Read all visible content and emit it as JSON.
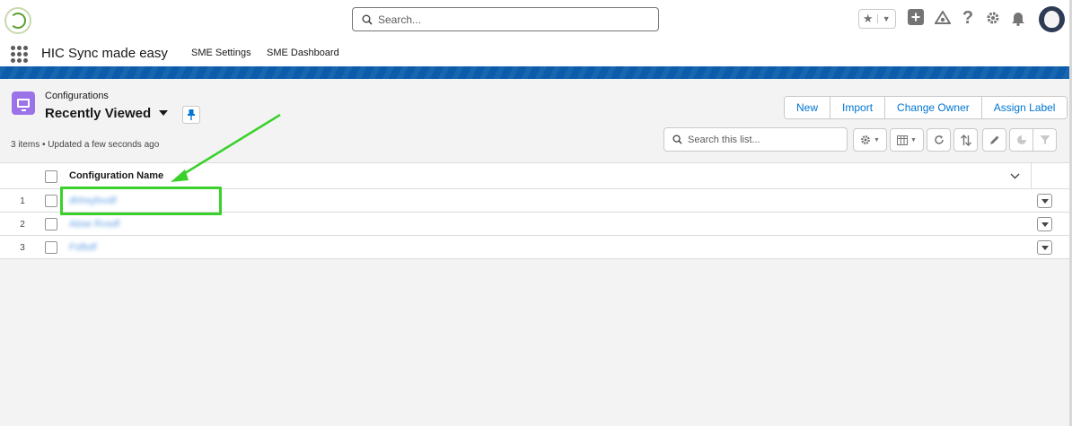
{
  "global_header": {
    "search_placeholder": "Search...",
    "utility_icons": [
      "favorites-star-icon",
      "add-icon",
      "trailhead-icon",
      "help-icon",
      "setup-gear-icon",
      "notifications-bell-icon"
    ],
    "help_glyph": "?"
  },
  "app_nav": {
    "app_name": "HIC Sync made easy",
    "items": [
      {
        "label": "SME Settings"
      },
      {
        "label": "SME Dashboard"
      }
    ]
  },
  "list_header": {
    "object_label": "Configurations",
    "list_view_name": "Recently Viewed",
    "meta_text": "3 items • Updated a few seconds ago",
    "actions": [
      {
        "label": "New"
      },
      {
        "label": "Import"
      },
      {
        "label": "Change Owner"
      },
      {
        "label": "Assign Label"
      }
    ],
    "search_placeholder": "Search this list...",
    "toolbar_icons": [
      "list-settings-icon",
      "display-as-table-icon",
      "refresh-icon",
      "sort-icon",
      "edit-list-icon",
      "charts-icon",
      "filter-icon"
    ]
  },
  "table": {
    "column_header": "Configuration Name",
    "rows": [
      {
        "num": "1",
        "name": "dhhsyfxvdf"
      },
      {
        "num": "2",
        "name": "Abse Rvsdf"
      },
      {
        "num": "3",
        "name": "Fsfbdf"
      }
    ]
  },
  "annotation": {
    "highlight_color": "#39d12a"
  },
  "colors": {
    "brand_blue": "#0176d3",
    "object_icon": "#9b72e8",
    "header_stripe": "#0b5cab"
  }
}
